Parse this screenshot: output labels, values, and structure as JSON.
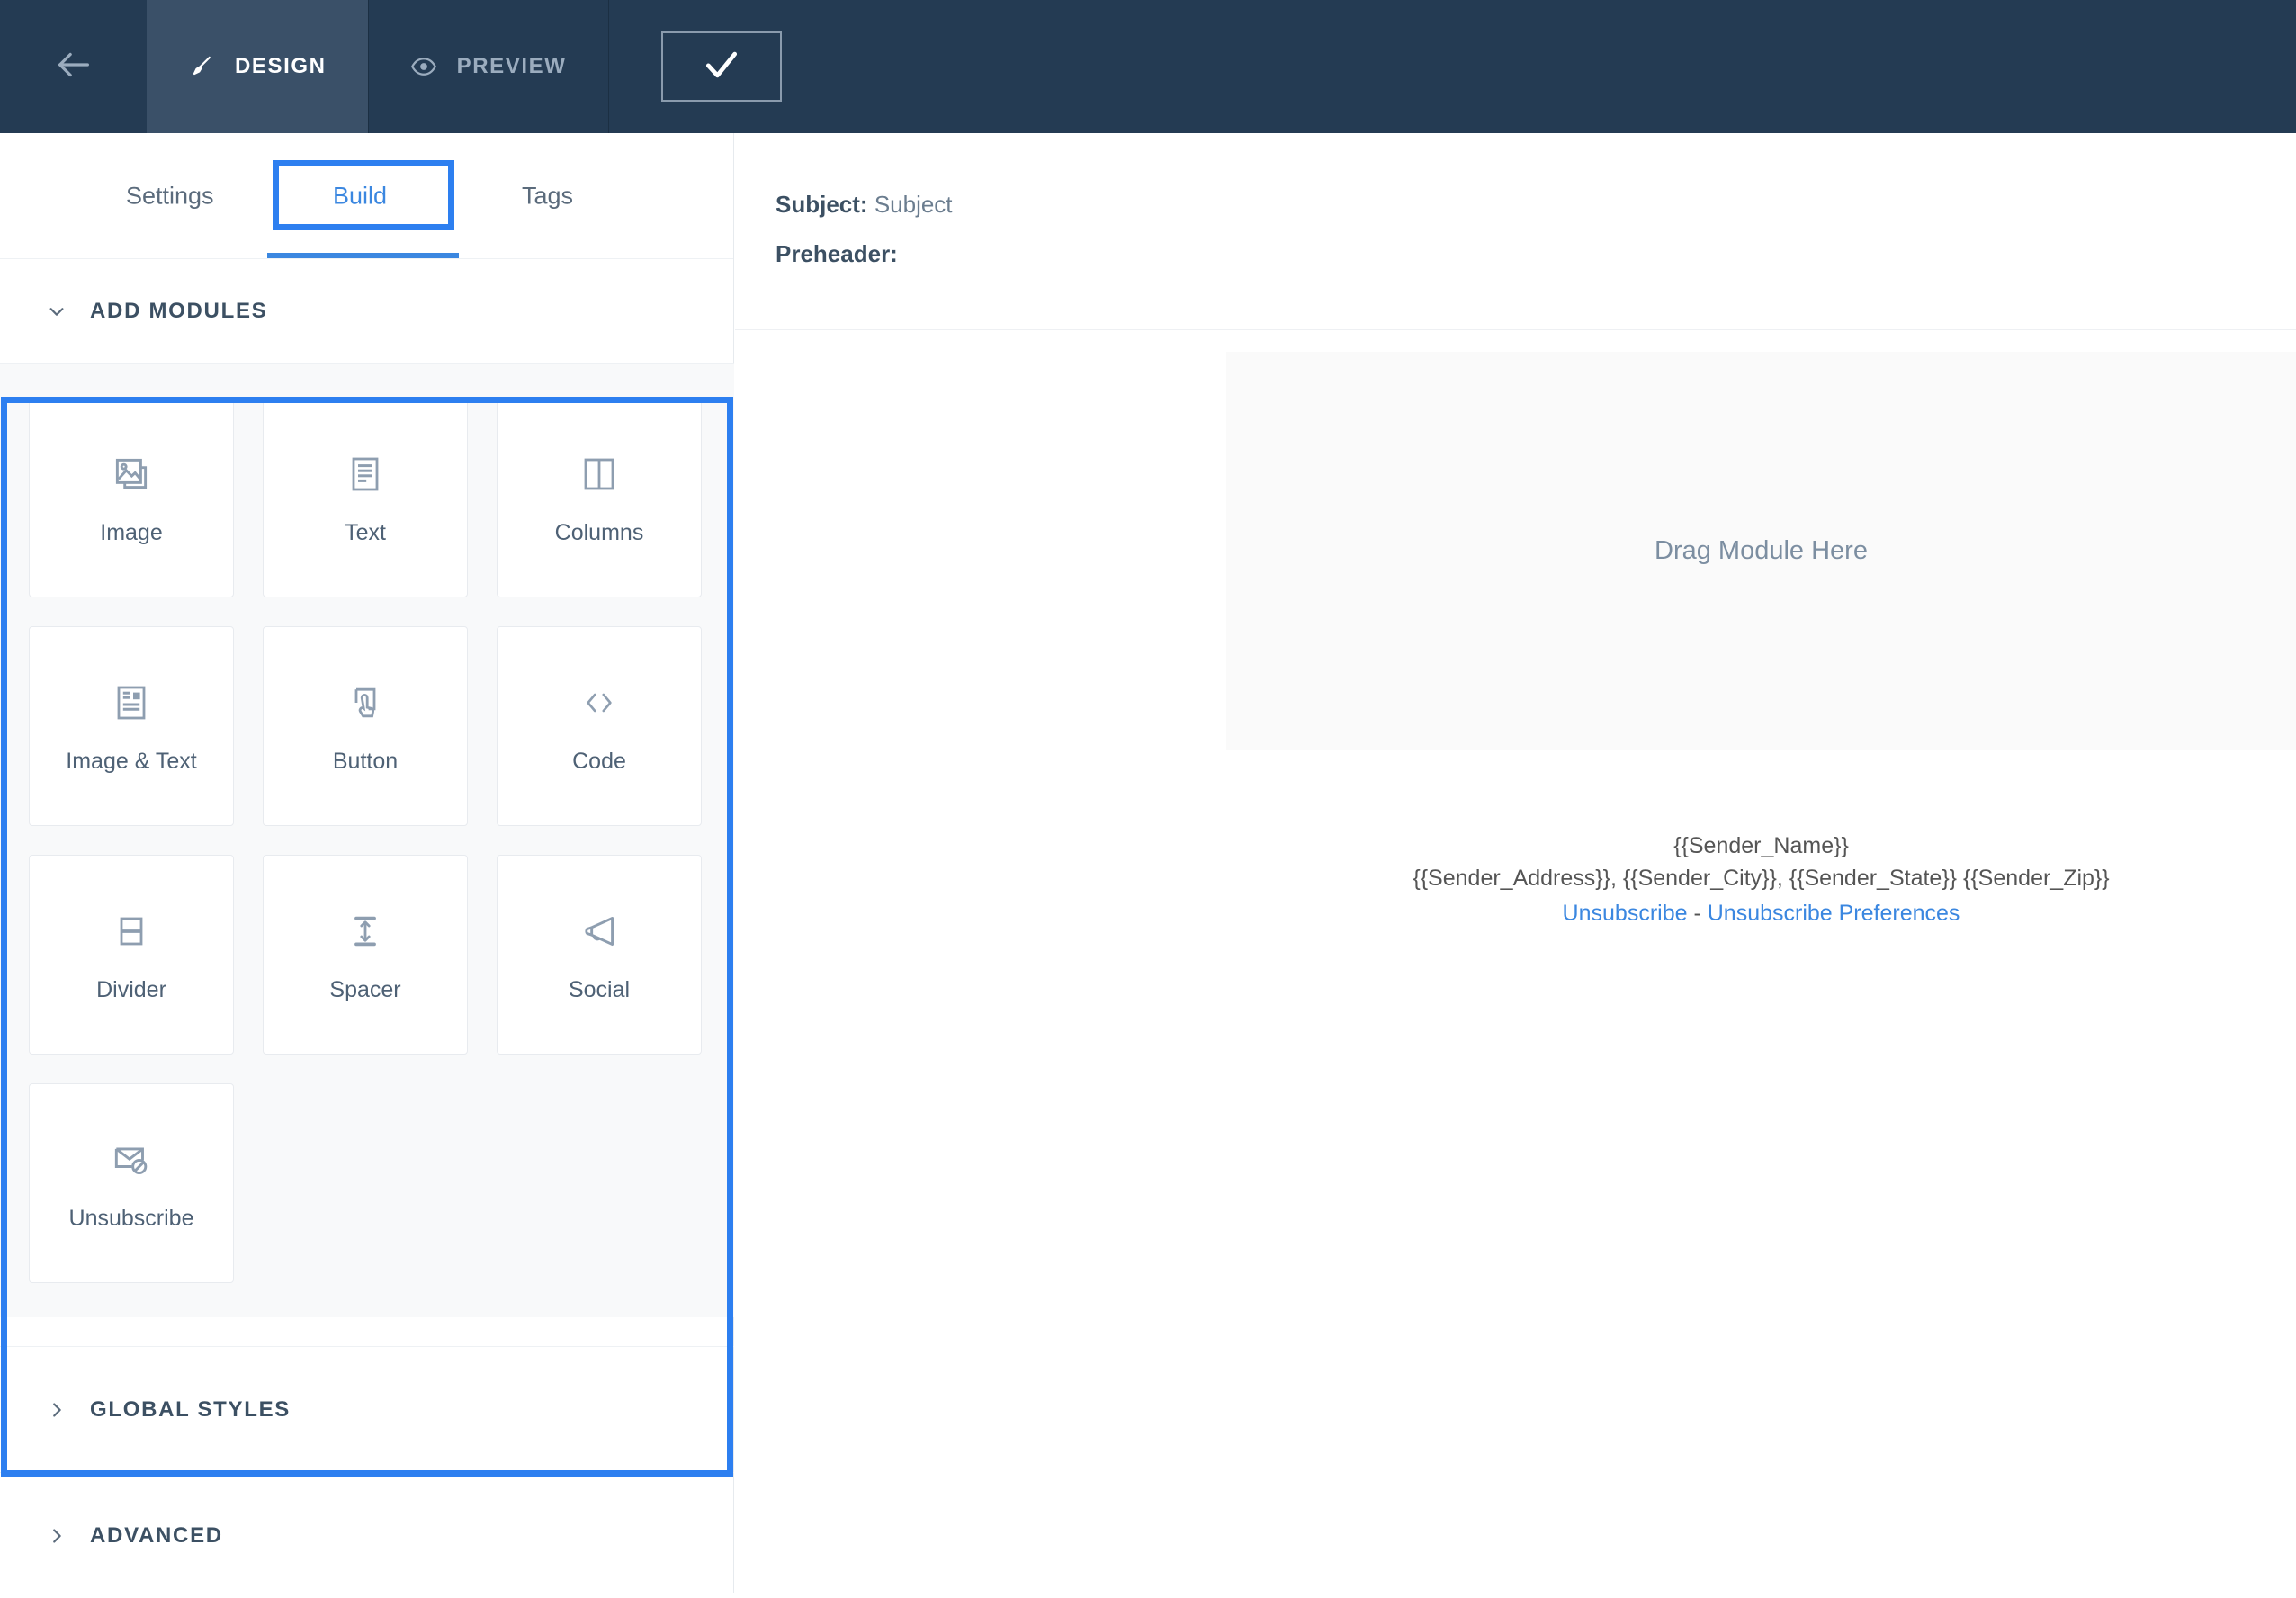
{
  "topbar": {
    "back_icon": "arrow-left-icon",
    "tabs": [
      {
        "label": "DESIGN",
        "icon": "brush-icon",
        "active": true
      },
      {
        "label": "PREVIEW",
        "icon": "eye-icon",
        "active": false
      }
    ],
    "confirm_icon": "check-icon"
  },
  "sidebar": {
    "tabs": [
      {
        "label": "Settings"
      },
      {
        "label": "Build"
      },
      {
        "label": "Tags"
      }
    ],
    "sections": [
      {
        "label": "ADD MODULES",
        "expanded": true,
        "chevron": "chevron-down-icon"
      },
      {
        "label": "GLOBAL STYLES",
        "expanded": false,
        "chevron": "chevron-right-icon"
      },
      {
        "label": "ADVANCED",
        "expanded": false,
        "chevron": "chevron-right-icon"
      }
    ],
    "modules": [
      {
        "label": "Image",
        "icon": "image-icon"
      },
      {
        "label": "Text",
        "icon": "text-document-icon"
      },
      {
        "label": "Columns",
        "icon": "columns-icon"
      },
      {
        "label": "Image & Text",
        "icon": "image-text-icon"
      },
      {
        "label": "Button",
        "icon": "button-pointer-icon"
      },
      {
        "label": "Code",
        "icon": "code-brackets-icon"
      },
      {
        "label": "Divider",
        "icon": "divider-icon"
      },
      {
        "label": "Spacer",
        "icon": "spacer-arrows-icon"
      },
      {
        "label": "Social",
        "icon": "megaphone-icon"
      },
      {
        "label": "Unsubscribe",
        "icon": "envelope-block-icon"
      }
    ]
  },
  "main": {
    "subject_key": "Subject:",
    "subject_value": "Subject",
    "preheader_key": "Preheader:",
    "preheader_value": "",
    "dropzone_label": "Drag Module Here",
    "footer": {
      "line1": "{{Sender_Name}}",
      "line2": "{{Sender_Address}}, {{Sender_City}}, {{Sender_State}} {{Sender_Zip}}",
      "unsubscribe_link": "Unsubscribe",
      "separator": "-",
      "preferences_link": "Unsubscribe Preferences"
    }
  },
  "colors": {
    "topbar_bg": "#243b53",
    "topbar_active_tab_bg": "#3a5068",
    "accent_blue": "#3b87e0",
    "highlight_blue": "#2d7ff0",
    "panel_bg": "#f8f9fa",
    "dropzone_bg": "#fafafa",
    "text_dark": "#3c5063",
    "text_muted": "#6b7d8f"
  }
}
